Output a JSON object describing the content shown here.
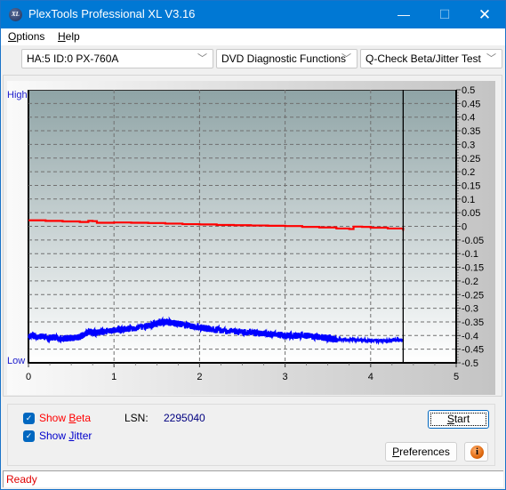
{
  "window": {
    "title": "PlexTools Professional XL V3.16",
    "icon_text": "XL",
    "minimize_icon": "—",
    "maximize_icon": "☐",
    "close_icon": "✕"
  },
  "menu": [
    {
      "label_u": "O",
      "label_rest": "ptions"
    },
    {
      "label_u": "H",
      "label_rest": "elp"
    }
  ],
  "toolbar": {
    "drive": "HA:5 ID:0  PX-760A",
    "category": "DVD Diagnostic Functions",
    "test": "Q-Check Beta/Jitter Test",
    "chevron": "﹀"
  },
  "chart_labels": {
    "high": "High",
    "low": "Low"
  },
  "chart_data": {
    "type": "line",
    "title": "",
    "xlabel": "",
    "ylabel": "",
    "xlim": [
      0,
      5
    ],
    "ylim": [
      -0.5,
      0.5
    ],
    "x_ticks": [
      "0",
      "1",
      "2",
      "3",
      "4",
      "5"
    ],
    "y_ticks": [
      "0.5",
      "0.45",
      "0.4",
      "0.35",
      "0.3",
      "0.25",
      "0.2",
      "0.15",
      "0.1",
      "0.05",
      "0",
      "-0.05",
      "-0.1",
      "-0.15",
      "-0.2",
      "-0.25",
      "-0.3",
      "-0.35",
      "-0.4",
      "-0.45",
      "-0.5"
    ],
    "grid": true,
    "position_marker_x": 4.38,
    "series": [
      {
        "name": "Beta",
        "color": "#ff0000",
        "x": [
          0,
          0.2,
          0.4,
          0.6,
          0.7,
          0.75,
          0.8,
          1.0,
          1.2,
          1.4,
          1.6,
          1.8,
          2.0,
          2.2,
          2.4,
          2.6,
          2.8,
          3.0,
          3.2,
          3.4,
          3.6,
          3.75,
          3.8,
          3.9,
          4.0,
          4.2,
          4.38
        ],
        "y": [
          0.022,
          0.02,
          0.018,
          0.016,
          0.02,
          0.019,
          0.013,
          0.014,
          0.013,
          0.012,
          0.01,
          0.008,
          0.007,
          0.005,
          0.004,
          0.003,
          0.002,
          0.001,
          -0.002,
          -0.004,
          -0.008,
          -0.01,
          -0.001,
          -0.002,
          -0.005,
          -0.008,
          -0.016
        ]
      },
      {
        "name": "Jitter",
        "color": "#0000ff",
        "x": [
          0,
          0.2,
          0.4,
          0.5,
          0.6,
          0.7,
          0.8,
          1.0,
          1.2,
          1.4,
          1.5,
          1.6,
          1.7,
          1.8,
          2.0,
          2.2,
          2.4,
          2.6,
          2.8,
          3.0,
          3.2,
          3.4,
          3.5,
          3.6,
          3.8,
          4.0,
          4.2,
          4.38
        ],
        "y": [
          -0.4,
          -0.405,
          -0.41,
          -0.41,
          -0.405,
          -0.385,
          -0.39,
          -0.38,
          -0.375,
          -0.365,
          -0.355,
          -0.35,
          -0.355,
          -0.36,
          -0.37,
          -0.38,
          -0.385,
          -0.39,
          -0.395,
          -0.4,
          -0.4,
          -0.405,
          -0.41,
          -0.415,
          -0.415,
          -0.418,
          -0.418,
          -0.415
        ]
      }
    ]
  },
  "controls": {
    "show_beta": {
      "prefix": "Show ",
      "u": "B",
      "rest": "eta",
      "checked": true,
      "color": "#ff0000"
    },
    "show_jitter": {
      "prefix": "Show ",
      "u": "J",
      "rest": "itter",
      "checked": true,
      "color": "#0000cc"
    },
    "check_mark": "✓",
    "lsn_label": "LSN:",
    "lsn_value": "2295040",
    "start_u": "S",
    "start_rest": "tart",
    "preferences_u": "P",
    "preferences_rest": "references",
    "info_icon": "i"
  },
  "status": {
    "text": "Ready"
  }
}
